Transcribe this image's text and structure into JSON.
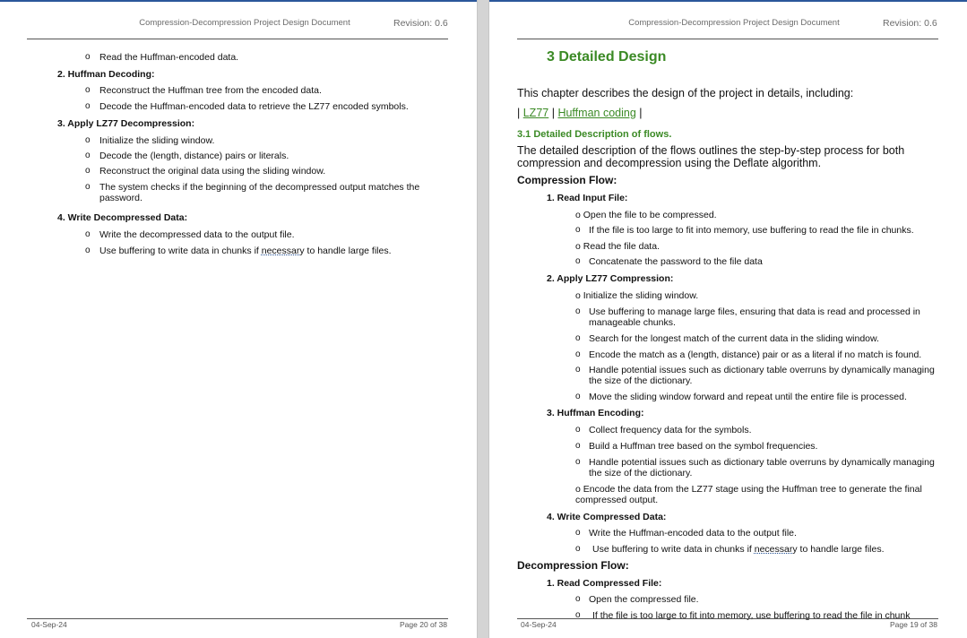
{
  "header": {
    "title": "Compression-Decompression Project Design Document",
    "revision": "Revision: 0.6"
  },
  "left_page": {
    "footer_date": "04-Sep-24",
    "footer_page": "Page 20 of 38",
    "l1": "Read the Huffman-encoded data.",
    "s2": "2. Huffman Decoding:",
    "l2a": "Reconstruct the Huffman tree from the encoded data.",
    "l2b": "Decode the Huffman-encoded data to retrieve the LZ77 encoded symbols.",
    "s3": "3. Apply LZ77 Decompression:",
    "l3a": "Initialize the sliding window.",
    "l3b": "Decode the (length, distance) pairs or literals.",
    "l3c": "Reconstruct the original data using the sliding window.",
    "l3d": "The system checks if the beginning of the decompressed output matches the password.",
    "s4": "4. Write Decompressed Data:",
    "l4a": "Write the decompressed data to the output file.",
    "l4b_pre": "Use buffering to write data in chunks if ",
    "l4b_word": "necessary",
    "l4b_post": " to handle large files."
  },
  "right_page": {
    "footer_date": "04-Sep-24",
    "footer_page": "Page 19 of 38",
    "h1": "3  Detailed Design",
    "intro": "This chapter describes the design of the project in details, including:",
    "link_sep": "|",
    "link1": "LZ77",
    "link2": "Huffman coding",
    "h2": "3.1  Detailed Description of flows.",
    "desc1": "The detailed description of the flows outlines the step-by-step process for both",
    "desc2": "compression and decompression using the Deflate algorithm.",
    "comp_flow": "Compression Flow:",
    "c1": "1. Read Input File:",
    "c1a": "o Open the file to be compressed.",
    "c1b": "If the file is too large to fit into memory, use buffering to read the file in chunks.",
    "c1c": "o Read the file data.",
    "c1d": "Concatenate the password to the file data",
    "c2": "2. Apply LZ77 Compression:",
    "c2a": "o Initialize the sliding window.",
    "c2b1": "Use buffering to manage large files, ensuring that data is read and processed in",
    "c2b2": "manageable chunks.",
    "c2c": "Search for the longest match of the current data in the sliding window.",
    "c2d": "Encode the match as a (length, distance) pair or as a literal if no match is found.",
    "c2e1": "Handle potential issues such as dictionary table overruns by dynamically managing",
    "c2e2": "the size of the dictionary.",
    "c2f": "Move the sliding window forward and repeat until the entire file is processed.",
    "c3": "3. Huffman Encoding:",
    "c3a": "Collect frequency data for the symbols.",
    "c3b": "Build a Huffman tree based on the symbol frequencies.",
    "c3c1": "Handle potential issues such as dictionary table overruns by dynamically managing",
    "c3c2": "the size of the dictionary.",
    "c3d1": "o  Encode the data from the LZ77 stage using the Huffman tree to generate the final",
    "c3d2": "compressed output.",
    "c4": "4. Write Compressed Data:",
    "c4a": "Write the Huffman-encoded data to the output file.",
    "c4b_pre": "Use buffering to write data in chunks if ",
    "c4b_word": "necessary",
    "c4b_post": " to handle large files.",
    "decomp_flow": "Decompression Flow:",
    "d1": "1. Read Compressed File:",
    "d1a": "Open the compressed file.",
    "d1b": "If the file is too large to fit into memory, use buffering to read the file in chunk"
  }
}
